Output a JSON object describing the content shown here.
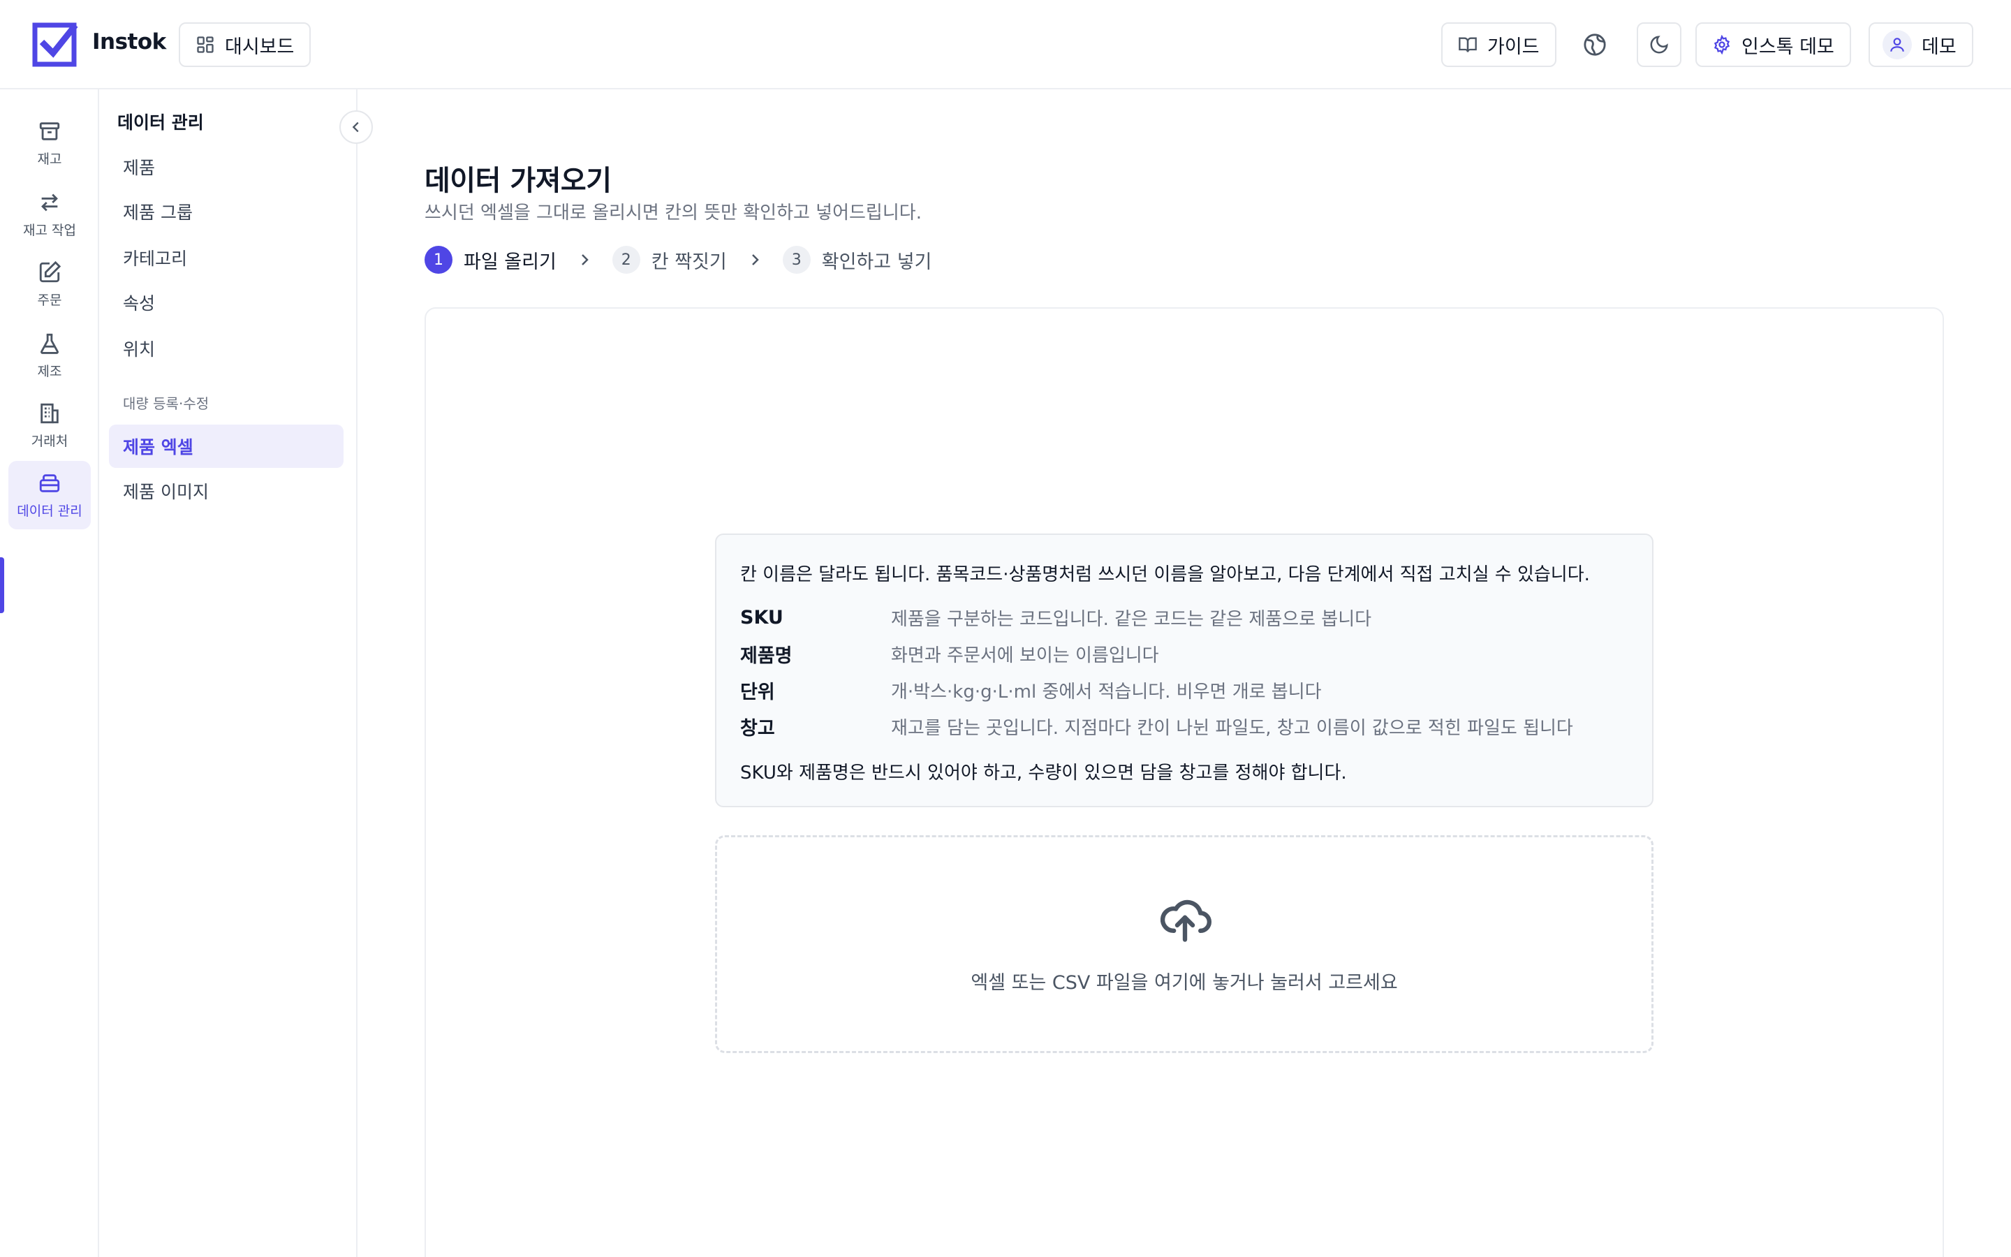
{
  "header": {
    "brand": "Instok",
    "dashboard_label": "대시보드",
    "guide_label": "가이드",
    "workspace_label": "인스톡 데모",
    "user_label": "데모"
  },
  "rail": {
    "items": [
      {
        "label": "재고",
        "icon": "archive-icon"
      },
      {
        "label": "재고 작업",
        "icon": "arrows-swap-icon"
      },
      {
        "label": "주문",
        "icon": "edit-note-icon"
      },
      {
        "label": "제조",
        "icon": "flask-icon"
      },
      {
        "label": "거래처",
        "icon": "building-icon"
      },
      {
        "label": "데이터 관리",
        "icon": "database-icon",
        "active": true
      }
    ]
  },
  "subnav": {
    "title": "데이터 관리",
    "items": [
      {
        "label": "제품"
      },
      {
        "label": "제품 그룹"
      },
      {
        "label": "카테고리"
      },
      {
        "label": "속성"
      },
      {
        "label": "위치"
      }
    ],
    "section_label": "대량 등록·수정",
    "bulk_items": [
      {
        "label": "제품 엑셀",
        "active": true
      },
      {
        "label": "제품 이미지"
      }
    ]
  },
  "main": {
    "title": "데이터 가져오기",
    "subtitle": "쓰시던 엑셀을 그대로 올리시면 칸의 뜻만 확인하고 넣어드립니다.",
    "steps": [
      {
        "num": "1",
        "label": "파일 올리기",
        "state": "current"
      },
      {
        "num": "2",
        "label": "칸 짝짓기",
        "state": "pending"
      },
      {
        "num": "3",
        "label": "확인하고 넣기",
        "state": "pending"
      }
    ],
    "info": {
      "intro": "칸 이름은 달라도 됩니다. 품목코드·상품명처럼 쓰시던 이름을 알아보고, 다음 단계에서 직접 고치실 수 있습니다.",
      "rows": [
        {
          "key": "SKU",
          "value": "제품을 구분하는 코드입니다. 같은 코드는 같은 제품으로 봅니다"
        },
        {
          "key": "제품명",
          "value": "화면과 주문서에 보이는 이름입니다"
        },
        {
          "key": "단위",
          "value": "개·박스·kg·g·L·ml 중에서 적습니다. 비우면 개로 봅니다"
        },
        {
          "key": "창고",
          "value": "재고를 담는 곳입니다. 지점마다 칸이 나뉜 파일도, 창고 이름이 값으로 적힌 파일도 됩니다"
        }
      ],
      "footer": "SKU와 제품명은 반드시 있어야 하고, 수량이 있으면 담을 창고를 정해야 합니다."
    },
    "dropzone": {
      "text": "엑셀 또는 CSV 파일을 여기에 놓거나 눌러서 고르세요",
      "icon": "cloud-upload-icon"
    }
  },
  "colors": {
    "accent": "#4f46e5",
    "accent_soft": "#efeefc",
    "border": "#e5e7eb",
    "muted_text": "#6b7280"
  }
}
